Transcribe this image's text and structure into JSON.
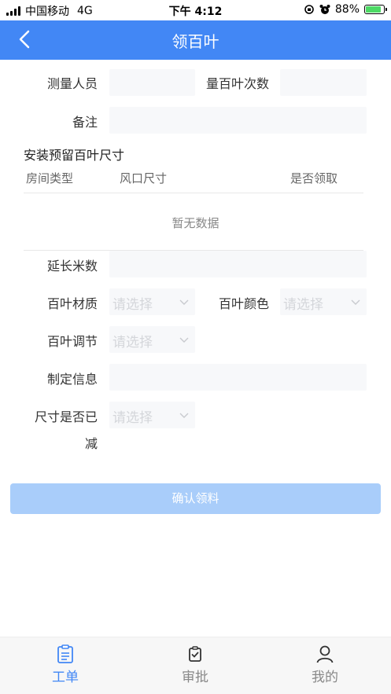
{
  "status_bar": {
    "carrier": "中国移动",
    "network": "4G",
    "time": "下午 4:12",
    "battery_percent": "88%",
    "battery_level": 0.88
  },
  "nav": {
    "title": "领百叶",
    "color": "#4287f5"
  },
  "form": {
    "surveyor_label": "测量人员",
    "surveyor_value": "",
    "count_label": "量百叶次数",
    "count_value": "",
    "remark_label": "备注",
    "remark_value": "",
    "section_title": "安装预留百叶尺寸",
    "table": {
      "columns": [
        "房间类型",
        "风口尺寸",
        "是否领取"
      ],
      "empty_text": "暂无数据"
    },
    "extension_label": "延长米数",
    "extension_value": "",
    "material_label": "百叶材质",
    "material_placeholder": "请选择",
    "color_label": "百叶颜色",
    "color_placeholder": "请选择",
    "adjust_label": "百叶调节",
    "adjust_placeholder": "请选择",
    "custom_info_label": "制定信息",
    "custom_info_value": "",
    "size_reduced_label_line1": "尺寸是否已",
    "size_reduced_label_line2": "减",
    "size_reduced_placeholder": "请选择"
  },
  "confirm_button": {
    "label": "确认领料",
    "color": "#a9cdfa"
  },
  "tabbar": {
    "tabs": [
      {
        "label": "工单",
        "icon": "clipboard-icon",
        "active": true
      },
      {
        "label": "审批",
        "icon": "approval-icon",
        "active": false
      },
      {
        "label": "我的",
        "icon": "user-icon",
        "active": false
      }
    ],
    "active_color": "#4287f5",
    "inactive_color": "#888888"
  }
}
